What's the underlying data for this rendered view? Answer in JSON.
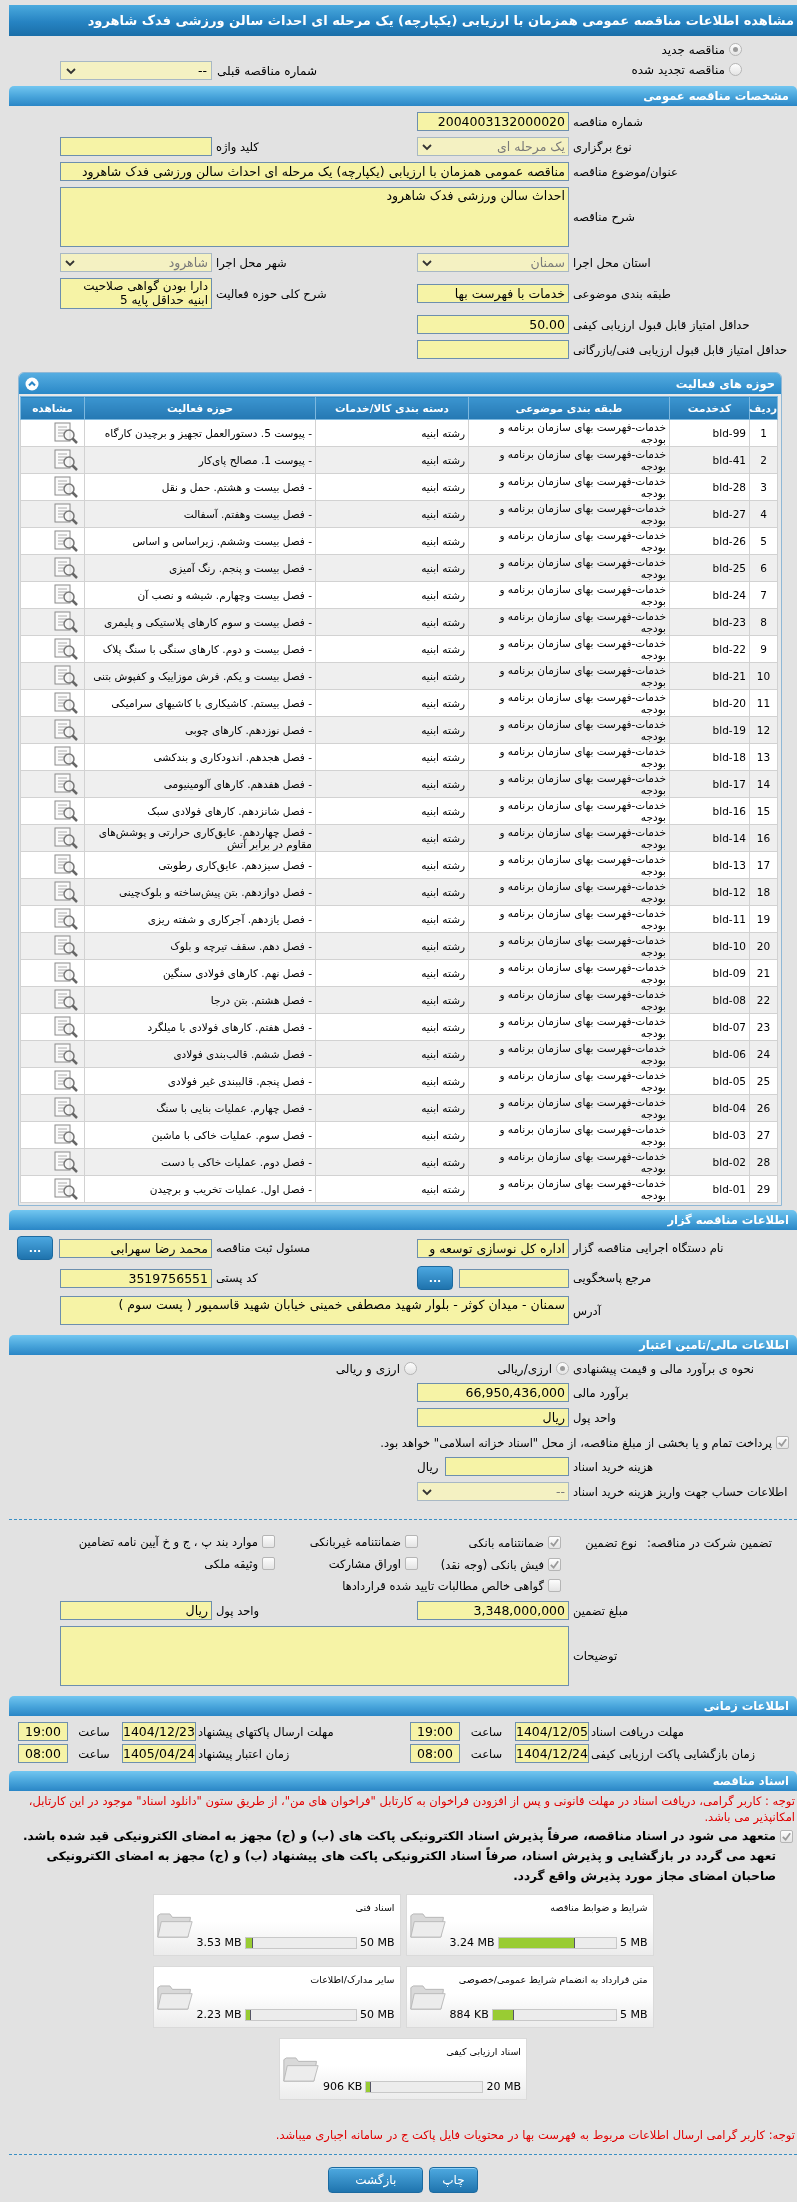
{
  "title": "مشاهده اطلاعات مناقصه عمومی همزمان با ارزیابی (یکپارچه) یک مرحله ای احداث سالن ورزشی فدک شاهرود",
  "tender_type": [
    {
      "label": "مناقصه جدید",
      "selected": true
    },
    {
      "label": "مناقصه تجدید شده",
      "selected": false
    }
  ],
  "previous_tender": {
    "label": "شماره مناقصه قبلی",
    "value": "--"
  },
  "general": {
    "header": "مشخصات مناقصه عمومی",
    "rows": [
      [
        {
          "label": "شماره مناقصه",
          "kind": "text",
          "value": "2004003132000020"
        }
      ],
      [
        {
          "label": "نوع برگزاری",
          "kind": "select",
          "value": "یک مرحله ای"
        },
        {
          "label": "کلید واژه",
          "kind": "text"
        }
      ],
      [
        {
          "label": "عنوان/موضوع مناقصه",
          "kind": "long_text",
          "value": "مناقصه عمومی همزمان با ارزیابی (یکپارچه) یک مرحله ای احداث سالن ورزشی فدک شاهرود"
        }
      ],
      [
        {
          "label": "شرح مناقصه",
          "kind": "memo",
          "value": "احداث سالن ورزشی فدک شاهرود"
        }
      ],
      [
        {
          "label": "استان محل اجرا",
          "kind": "select",
          "value": "سمنان"
        },
        {
          "label": "شهر محل اجرا",
          "kind": "select",
          "value": "شاهرود"
        }
      ],
      [
        {
          "label": "طبقه بندی موضوعی",
          "kind": "text",
          "value": "خدمات با فهرست بها"
        },
        {
          "label": "شرح کلی حوزه فعالیت",
          "kind": "note",
          "value": "دارا بودن گواهی صلاحیت ابنیه حداقل پایه 5"
        }
      ],
      [
        {
          "label": "حداقل امتیاز قابل قبول ارزیابی کیفی",
          "kind": "text",
          "value": "50.00"
        }
      ],
      [
        {
          "label": "حداقل امتیاز قابل قبول ارزیابی فنی/بازرگانی",
          "kind": "text"
        }
      ]
    ]
  },
  "activities": {
    "header": "حوزه های فعالیت",
    "columns": [
      "ردیف",
      "کدخدمت",
      "طبقه بندی موضوعی",
      "دسته بندی کالا/خدمات",
      "حوزه فعالیت",
      "مشاهده"
    ],
    "rows": [
      {
        "index": "1",
        "code": "bld-99",
        "category": "خدمات-فهرست بهای سازمان برنامه و بودجه",
        "group": "رشته ابنیه",
        "activity": "- پیوست 5. دستورالعمل تجهیز و برچیدن کارگاه"
      },
      {
        "index": "2",
        "code": "bld-41",
        "category": "خدمات-فهرست بهای سازمان برنامه و بودجه",
        "group": "رشته ابنیه",
        "activity": "- پیوست 1. مصالح پای‌کار"
      },
      {
        "index": "3",
        "code": "bld-28",
        "category": "خدمات-فهرست بهای سازمان برنامه و بودجه",
        "group": "رشته ابنیه",
        "activity": "- فصل بیست و هشتم. حمل و نقل"
      },
      {
        "index": "4",
        "code": "bld-27",
        "category": "خدمات-فهرست بهای سازمان برنامه و بودجه",
        "group": "رشته ابنیه",
        "activity": "- فصل بیست وهفتم. آسفالت"
      },
      {
        "index": "5",
        "code": "bld-26",
        "category": "خدمات-فهرست بهای سازمان برنامه و بودجه",
        "group": "رشته ابنیه",
        "activity": "- فصل بیست وششم. زیراساس و اساس"
      },
      {
        "index": "6",
        "code": "bld-25",
        "category": "خدمات-فهرست بهای سازمان برنامه و بودجه",
        "group": "رشته ابنیه",
        "activity": "- فصل بیست و پنجم. رنگ آمیزی"
      },
      {
        "index": "7",
        "code": "bld-24",
        "category": "خدمات-فهرست بهای سازمان برنامه و بودجه",
        "group": "رشته ابنیه",
        "activity": "- فصل بیست وچهارم. شیشه و نصب آن"
      },
      {
        "index": "8",
        "code": "bld-23",
        "category": "خدمات-فهرست بهای سازمان برنامه و بودجه",
        "group": "رشته ابنیه",
        "activity": "- فصل بیست و سوم کارهای پلاستیکی و پلیمری"
      },
      {
        "index": "9",
        "code": "bld-22",
        "category": "خدمات-فهرست بهای سازمان برنامه و بودجه",
        "group": "رشته ابنیه",
        "activity": "- فصل بیست و دوم. کارهای سنگی با سنگ پلاک"
      },
      {
        "index": "10",
        "code": "bld-21",
        "category": "خدمات-فهرست بهای سازمان برنامه و بودجه",
        "group": "رشته ابنیه",
        "activity": "- فصل بیست و یکم. فرش موزاییک و کفپوش بتنی"
      },
      {
        "index": "11",
        "code": "bld-20",
        "category": "خدمات-فهرست بهای سازمان برنامه و بودجه",
        "group": "رشته ابنیه",
        "activity": "- فصل بیستم. کاشیکاری با کاشیهای سرامیکی"
      },
      {
        "index": "12",
        "code": "bld-19",
        "category": "خدمات-فهرست بهای سازمان برنامه و بودجه",
        "group": "رشته ابنیه",
        "activity": "- فصل نوزدهم. کارهای چوبی"
      },
      {
        "index": "13",
        "code": "bld-18",
        "category": "خدمات-فهرست بهای سازمان برنامه و بودجه",
        "group": "رشته ابنیه",
        "activity": "- فصل هجدهم. اندودکاری و بندکشی"
      },
      {
        "index": "14",
        "code": "bld-17",
        "category": "خدمات-فهرست بهای سازمان برنامه و بودجه",
        "group": "رشته ابنیه",
        "activity": "- فصل هفدهم. کارهای آلومینیومی"
      },
      {
        "index": "15",
        "code": "bld-16",
        "category": "خدمات-فهرست بهای سازمان برنامه و بودجه",
        "group": "رشته ابنیه",
        "activity": "- فصل شانزدهم. کارهای فولادی سبک"
      },
      {
        "index": "16",
        "code": "bld-14",
        "category": "خدمات-فهرست بهای سازمان برنامه و بودجه",
        "group": "رشته ابنیه",
        "activity": "- فصل چهاردهم. عایق‌کاری حرارتی و پوشش‌های مقاوم در برابر آتش"
      },
      {
        "index": "17",
        "code": "bld-13",
        "category": "خدمات-فهرست بهای سازمان برنامه و بودجه",
        "group": "رشته ابنیه",
        "activity": "- فصل سیزدهم. عایق‌کاری رطوبتی"
      },
      {
        "index": "18",
        "code": "bld-12",
        "category": "خدمات-فهرست بهای سازمان برنامه و بودجه",
        "group": "رشته ابنیه",
        "activity": "- فصل دوازدهم. بتن پیش‌ساخته و بلوک‌چینی"
      },
      {
        "index": "19",
        "code": "bld-11",
        "category": "خدمات-فهرست بهای سازمان برنامه و بودجه",
        "group": "رشته ابنیه",
        "activity": "- فصل یازدهم. آجرکاری و شفته ریزی"
      },
      {
        "index": "20",
        "code": "bld-10",
        "category": "خدمات-فهرست بهای سازمان برنامه و بودجه",
        "group": "رشته ابنیه",
        "activity": "- فصل دهم. سقف تیرچه و بلوک"
      },
      {
        "index": "21",
        "code": "bld-09",
        "category": "خدمات-فهرست بهای سازمان برنامه و بودجه",
        "group": "رشته ابنیه",
        "activity": "- فصل نهم. کارهای فولادی سنگین"
      },
      {
        "index": "22",
        "code": "bld-08",
        "category": "خدمات-فهرست بهای سازمان برنامه و بودجه",
        "group": "رشته ابنیه",
        "activity": "- فصل هشتم. بتن درجا"
      },
      {
        "index": "23",
        "code": "bld-07",
        "category": "خدمات-فهرست بهای سازمان برنامه و بودجه",
        "group": "رشته ابنیه",
        "activity": "- فصل هفتم. کارهای فولادی با میلگرد"
      },
      {
        "index": "24",
        "code": "bld-06",
        "category": "خدمات-فهرست بهای سازمان برنامه و بودجه",
        "group": "رشته ابنیه",
        "activity": "- فصل ششم. قالب‌بندی فولادی"
      },
      {
        "index": "25",
        "code": "bld-05",
        "category": "خدمات-فهرست بهای سازمان برنامه و بودجه",
        "group": "رشته ابنیه",
        "activity": "- فصل پنجم. قالببندی غیر فولادی"
      },
      {
        "index": "26",
        "code": "bld-04",
        "category": "خدمات-فهرست بهای سازمان برنامه و بودجه",
        "group": "رشته ابنیه",
        "activity": "- فصل چهارم. عملیات بنایی با سنگ"
      },
      {
        "index": "27",
        "code": "bld-03",
        "category": "خدمات-فهرست بهای سازمان برنامه و بودجه",
        "group": "رشته ابنیه",
        "activity": "- فصل سوم. عملیات خاکی با ماشین"
      },
      {
        "index": "28",
        "code": "bld-02",
        "category": "خدمات-فهرست بهای سازمان برنامه و بودجه",
        "group": "رشته ابنیه",
        "activity": "- فصل دوم. عملیات خاکی با دست"
      },
      {
        "index": "29",
        "code": "bld-01",
        "category": "خدمات-فهرست بهای سازمان برنامه و بودجه",
        "group": "رشته ابنیه",
        "activity": "- فصل اول. عملیات تخریب و برچیدن"
      }
    ]
  },
  "tenderer": {
    "header": "اطلاعات مناقصه گزار",
    "rows": [
      [
        {
          "label": "نام دستگاه اجرایی مناقصه گزار",
          "kind": "text",
          "value": "اداره کل نوسازی توسعه و"
        },
        {
          "label": "مسئول ثبت مناقصه",
          "kind": "text",
          "value": "محمد رضا سهرابی",
          "button": "..."
        }
      ],
      [
        {
          "label": "مرجع پاسخگویی",
          "kind": "text",
          "button": "..."
        },
        {
          "label": "کد پستی",
          "kind": "text",
          "value": "3519756551"
        }
      ],
      [
        {
          "label": "آدرس",
          "kind": "box",
          "value": "سمنان - میدان کوثر - بلوار شهید مصطفی خمینی خیابان شهید قاسمپور ( پست سوم )"
        }
      ]
    ]
  },
  "financial": {
    "header": "اطلاعات مالی/تامین اعتبار",
    "rows": [
      [
        {
          "label": "نحوه ی برآورد مالی و قیمت پیشنهادی",
          "kind": "radio",
          "options": [
            {
              "label": "ارزی/ریالی",
              "selected": true
            },
            {
              "label": "ارزی و ریالی",
              "selected": false
            }
          ]
        }
      ],
      [
        {
          "label": "برآورد مالی",
          "kind": "text",
          "value": "66,950,436,000"
        }
      ],
      [
        {
          "label": "واحد پول",
          "kind": "text",
          "value": "ریال"
        }
      ]
    ],
    "treasury": {
      "label": "پرداخت تمام و یا بخشی از مبلغ مناقصه، از محل \"اسناد خزانه اسلامی\" خواهد بود.",
      "checked": true
    },
    "fee_rows": [
      [
        {
          "label": "هزینه خرید اسناد",
          "kind": "text",
          "unit": "ریال"
        }
      ],
      [
        {
          "label": "اطلاعات حساب جهت واریز هزینه خرید اسناد",
          "kind": "select",
          "value": "--"
        }
      ]
    ],
    "guarantee": {
      "label": "تضمین شرکت در مناقصه:",
      "type_label": "نوع تضمین",
      "options": [
        {
          "label": "ضمانتنامه بانکی",
          "checked": true
        },
        {
          "label": "ضمانتنامه غیربانکی",
          "checked": false
        },
        {
          "label": "موارد بند پ ، ج و خ آیین نامه تضامین",
          "checked": false
        },
        {
          "label": "فیش بانکی (وجه نقد)",
          "checked": true
        },
        {
          "label": "اوراق مشارکت",
          "checked": false
        },
        {
          "label": "وثیقه ملکی",
          "checked": false
        },
        {
          "label": "گواهی خالص مطالبات تایید شده قراردادها",
          "checked": false
        }
      ]
    },
    "amount_rows": [
      [
        {
          "label": "مبلغ تضمین",
          "kind": "text",
          "value": "3,348,000,000"
        },
        {
          "label": "واحد پول",
          "kind": "text",
          "value": "ریال"
        }
      ],
      [
        {
          "label": "توضیحات",
          "kind": "memo"
        }
      ]
    ]
  },
  "timing": {
    "header": "اطلاعات زمانی",
    "items": [
      {
        "label": "مهلت دریافت اسناد",
        "date": "1404/12/05",
        "time_label": "ساعت",
        "time": "19:00"
      },
      {
        "label": "مهلت ارسال پاکتهای پیشنهاد",
        "date": "1404/12/23",
        "time_label": "ساعت",
        "time": "19:00"
      },
      {
        "label": "زمان بازگشایی پاکت ارزیابی کیفی",
        "date": "1404/12/24",
        "time_label": "ساعت",
        "time": "08:00"
      },
      {
        "label": "زمان اعتبار پیشنهاد",
        "date": "1405/04/24",
        "time_label": "ساعت",
        "time": "08:00"
      }
    ]
  },
  "documents": {
    "header": "اسناد مناقصه",
    "notice": "توجه : کاربر گرامی، دریافت اسناد در مهلت قانونی و پس از افزودن فراخوان به کارتابل \"فراخوان های من\"، از طریق ستون \"دانلود اسناد\" موجود در این کارتابل، امکانپذیر می باشد.",
    "commitment": {
      "text": "متعهد می شود در اسناد مناقصه، صرفاً پذیرش اسناد الکترونیکی پاکت های (ب) و (ج) مجهز به امضای الکترونیکی قید شده باشد. تعهد می گردد در بازگشایی و پذیرش اسناد، صرفاً اسناد الکترونیکی پاکت های پیشنهاد (ب) و (ج) مجهز به امضای الکترونیکی صاحبان امضای مجاز مورد پذیرش واقع گردد.",
      "checked": true
    },
    "files": [
      {
        "title": "شرایط و ضوابط مناقصه",
        "max": "5 MB",
        "used": "3.24 MB",
        "level": 0.648
      },
      {
        "title": "اسناد فنی",
        "max": "50 MB",
        "used": "3.53 MB",
        "level": 0.07
      },
      {
        "title": "متن قرارداد به انضمام شرایط عمومی/خصوصی",
        "max": "5 MB",
        "used": "884 KB",
        "level": 0.17
      },
      {
        "title": "سایر مدارک/اطلاعات",
        "max": "50 MB",
        "used": "2.23 MB",
        "level": 0.045
      },
      {
        "title": "اسناد ارزیابی کیفی",
        "max": "20 MB",
        "used": "906 KB",
        "level": 0.044
      }
    ],
    "footer_note": "توجه: کاربر گرامی ارسال اطلاعات مربوط به فهرست بها در محتویات فایل پاکت ج در سامانه اجباری میباشد.",
    "buttons": [
      "چاپ",
      "بازگشت"
    ]
  }
}
